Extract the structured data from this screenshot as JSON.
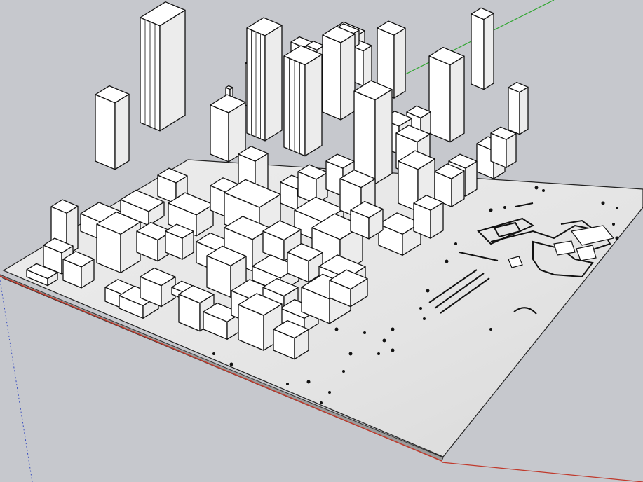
{
  "viewport": {
    "background": "#c6c8cd",
    "ground_color": "#e7e7e7",
    "building_face_light": "#ffffff",
    "building_face_shade": "#ececec",
    "edge_color": "#111111",
    "axis_colors": {
      "red": "#c0392b",
      "green": "#2aa52a",
      "blue": "#3a4fc0"
    }
  }
}
